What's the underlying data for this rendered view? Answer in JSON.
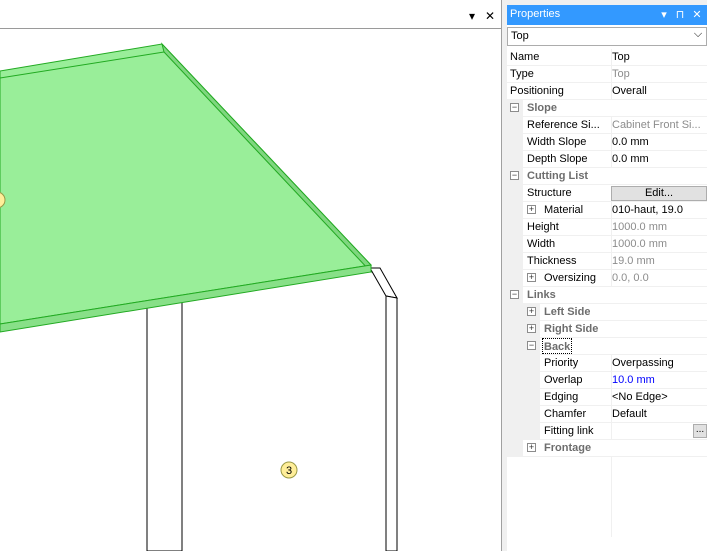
{
  "viewport": {
    "bubble_label": "3",
    "dropdown_glyph": "▾",
    "close_glyph": "✕"
  },
  "properties": {
    "title": "Properties",
    "title_buttons": {
      "dropdown": "▾",
      "pin": "⊓",
      "close": "✕"
    },
    "object_select": {
      "value": "Top",
      "arrow": "⌵"
    },
    "rows": {
      "name": {
        "label": "Name",
        "value": "Top"
      },
      "type": {
        "label": "Type",
        "value": "Top"
      },
      "positioning": {
        "label": "Positioning",
        "value": "Overall"
      },
      "slope": {
        "label": "Slope"
      },
      "reference": {
        "label": "Reference Si...",
        "value": "Cabinet Front Si..."
      },
      "width_slope": {
        "label": "Width Slope",
        "value": "0.0 mm"
      },
      "depth_slope": {
        "label": "Depth Slope",
        "value": "0.0 mm"
      },
      "cutting": {
        "label": "Cutting List"
      },
      "structure": {
        "label": "Structure",
        "value": "Edit..."
      },
      "material": {
        "label": "Material",
        "value": "010-haut, 19.0"
      },
      "height": {
        "label": "Height",
        "value": "1000.0 mm"
      },
      "width": {
        "label": "Width",
        "value": "1000.0 mm"
      },
      "thickness": {
        "label": "Thickness",
        "value": "19.0 mm"
      },
      "oversizing": {
        "label": "Oversizing",
        "value": "0.0, 0.0"
      },
      "links": {
        "label": "Links"
      },
      "left_side": {
        "label": "Left Side"
      },
      "right_side": {
        "label": "Right Side"
      },
      "back": {
        "label": "Back"
      },
      "priority": {
        "label": "Priority",
        "value": "Overpassing"
      },
      "overlap": {
        "label": "Overlap",
        "value": "10.0 mm"
      },
      "edging": {
        "label": "Edging",
        "value": "<No Edge>"
      },
      "chamfer": {
        "label": "Chamfer",
        "value": "Default"
      },
      "fitting": {
        "label": "Fitting link",
        "value": "",
        "button": "..."
      },
      "frontage": {
        "label": "Frontage"
      }
    },
    "toggle_expanded": "−",
    "toggle_collapsed": "+"
  },
  "colors": {
    "title_bar": "#3399ff",
    "panel_fill": "#99ee99",
    "panel_edge": "#22aa22",
    "bubble": "#ffee99",
    "link_value": "#0000ff"
  }
}
